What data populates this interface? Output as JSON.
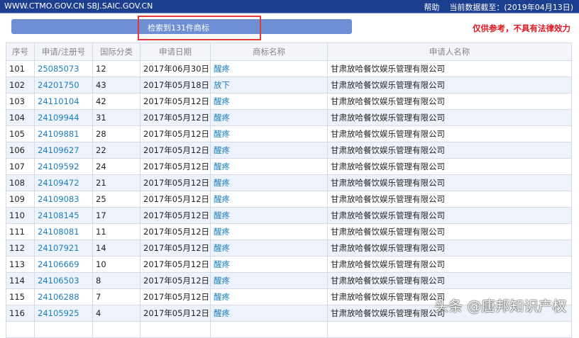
{
  "header": {
    "site": "WWW.CTMO.GOV.CN SBJ.SAIC.GOV.CN",
    "help": "帮助",
    "data_date": "当前数据截至：(2019年04月13日)"
  },
  "search_result": "检索到131件商标",
  "disclaimer": "仅供参考，不具有法律效力",
  "columns": [
    "序号",
    "申请/注册号",
    "国际分类",
    "申请日期",
    "商标名称",
    "申请人名称"
  ],
  "rows": [
    [
      "101",
      "25085073",
      "12",
      "2017年06月30日",
      "醒疼",
      "甘肃放哈餐饮娱乐管理有限公司"
    ],
    [
      "102",
      "24201750",
      "43",
      "2017年05月18日",
      "放下",
      "甘肃放哈餐饮娱乐管理有限公司"
    ],
    [
      "103",
      "24110104",
      "42",
      "2017年05月12日",
      "醒疼",
      "甘肃放哈餐饮娱乐管理有限公司"
    ],
    [
      "104",
      "24109944",
      "31",
      "2017年05月12日",
      "醒疼",
      "甘肃放哈餐饮娱乐管理有限公司"
    ],
    [
      "105",
      "24109881",
      "28",
      "2017年05月12日",
      "醒疼",
      "甘肃放哈餐饮娱乐管理有限公司"
    ],
    [
      "106",
      "24109627",
      "22",
      "2017年05月12日",
      "醒疼",
      "甘肃放哈餐饮娱乐管理有限公司"
    ],
    [
      "107",
      "24109592",
      "24",
      "2017年05月12日",
      "醒疼",
      "甘肃放哈餐饮娱乐管理有限公司"
    ],
    [
      "108",
      "24109472",
      "21",
      "2017年05月12日",
      "醒疼",
      "甘肃放哈餐饮娱乐管理有限公司"
    ],
    [
      "109",
      "24109083",
      "25",
      "2017年05月12日",
      "醒疼",
      "甘肃放哈餐饮娱乐管理有限公司"
    ],
    [
      "110",
      "24108145",
      "17",
      "2017年05月12日",
      "醒疼",
      "甘肃放哈餐饮娱乐管理有限公司"
    ],
    [
      "111",
      "24108081",
      "11",
      "2017年05月12日",
      "醒疼",
      "甘肃放哈餐饮娱乐管理有限公司"
    ],
    [
      "112",
      "24107921",
      "14",
      "2017年05月12日",
      "醒疼",
      "甘肃放哈餐饮娱乐管理有限公司"
    ],
    [
      "113",
      "24106669",
      "10",
      "2017年05月12日",
      "醒疼",
      "甘肃放哈餐饮娱乐管理有限公司"
    ],
    [
      "114",
      "24106503",
      "8",
      "2017年05月12日",
      "醒疼",
      "甘肃放哈餐饮娱乐管理有限公司"
    ],
    [
      "115",
      "24106288",
      "7",
      "2017年05月12日",
      "醒疼",
      "甘肃放哈餐饮娱乐管理有限公司"
    ],
    [
      "116",
      "24105925",
      "4",
      "2017年05月12日",
      "醒疼",
      "甘肃放哈餐饮娱乐管理有限公司"
    ]
  ],
  "watermark": "头条 @唐邦知识产权"
}
